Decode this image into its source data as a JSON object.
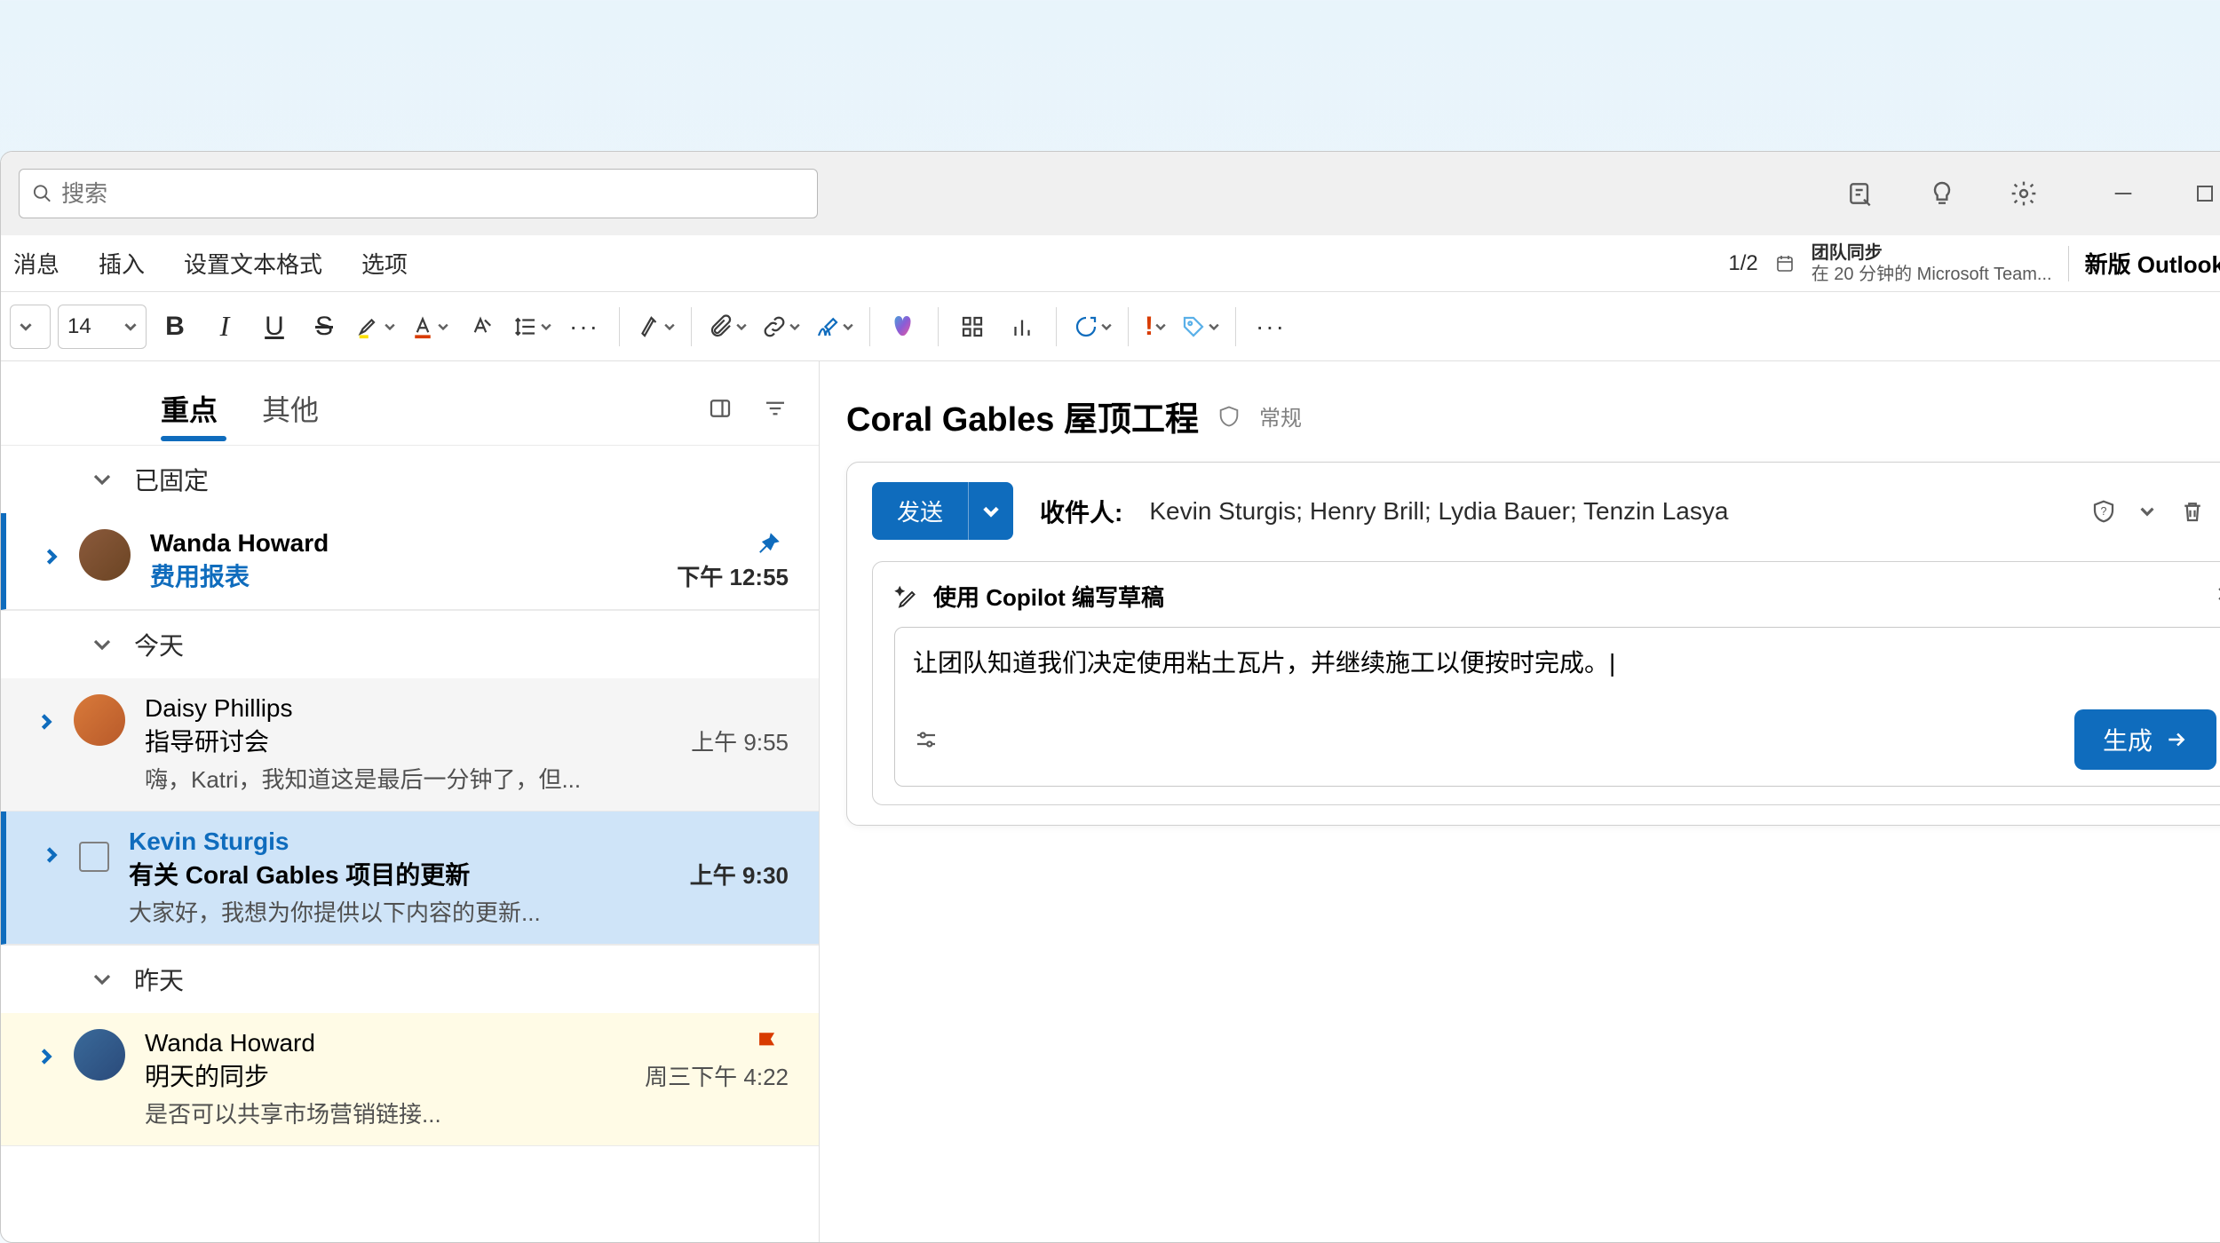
{
  "titlebar": {
    "search_placeholder": "搜索"
  },
  "menubar": {
    "tab_message": "消息",
    "tab_insert": "插入",
    "tab_format": "设置文本格式",
    "tab_options": "选项",
    "counter": "1/2",
    "teams_title": "团队同步",
    "teams_sub": "在 20 分钟的 Microsoft Team...",
    "new_outlook": "新版 Outlook"
  },
  "toolbar": {
    "font_size": "14"
  },
  "list": {
    "tab_focus": "重点",
    "tab_other": "其他",
    "section_pinned": "已固定",
    "section_today": "今天",
    "section_yesterday": "昨天",
    "emails": [
      {
        "from": "Wanda Howard",
        "subject": "费用报表",
        "time": "下午 12:55"
      },
      {
        "from": "Daisy Phillips",
        "subject": "指导研讨会",
        "time": "上午 9:55",
        "preview": "嗨，Katri，我知道这是最后一分钟了，但..."
      },
      {
        "from": "Kevin Sturgis",
        "subject": "有关 Coral Gables 项目的更新",
        "time": "上午 9:30",
        "preview": "大家好，我想为你提供以下内容的更新..."
      },
      {
        "from": "Wanda Howard",
        "subject": "明天的同步",
        "time": "周三下午 4:22",
        "preview": "是否可以共享市场营销链接..."
      }
    ]
  },
  "reading": {
    "title": "Coral Gables 屋顶工程",
    "tag": "常规",
    "send_label": "发送",
    "recipients_label": "收件人:",
    "recipients": "Kevin Sturgis; Henry Brill; Lydia Bauer; Tenzin Lasya",
    "copilot_title": "使用 Copilot 编写草稿",
    "copilot_text": "让团队知道我们决定使用粘土瓦片，并继续施工以便按时完成。",
    "generate_label": "生成"
  }
}
